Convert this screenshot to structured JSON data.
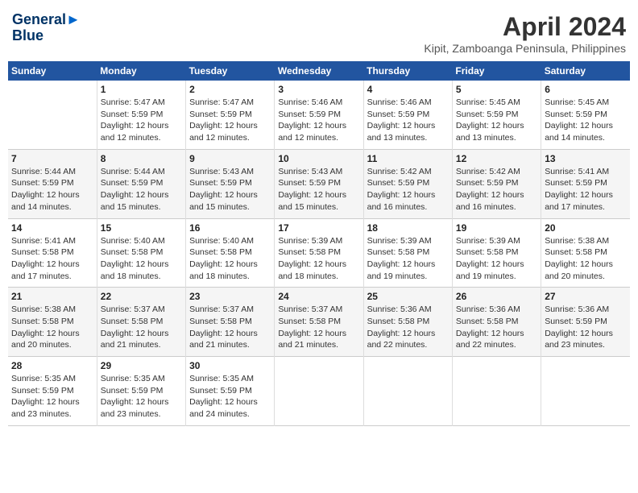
{
  "header": {
    "logo": {
      "line1": "General",
      "line2": "Blue"
    },
    "title": "April 2024",
    "subtitle": "Kipit, Zamboanga Peninsula, Philippines"
  },
  "calendar": {
    "days_header": [
      "Sunday",
      "Monday",
      "Tuesday",
      "Wednesday",
      "Thursday",
      "Friday",
      "Saturday"
    ],
    "weeks": [
      {
        "days": [
          {
            "num": "",
            "info": ""
          },
          {
            "num": "1",
            "info": "Sunrise: 5:47 AM\nSunset: 5:59 PM\nDaylight: 12 hours\nand 12 minutes."
          },
          {
            "num": "2",
            "info": "Sunrise: 5:47 AM\nSunset: 5:59 PM\nDaylight: 12 hours\nand 12 minutes."
          },
          {
            "num": "3",
            "info": "Sunrise: 5:46 AM\nSunset: 5:59 PM\nDaylight: 12 hours\nand 12 minutes."
          },
          {
            "num": "4",
            "info": "Sunrise: 5:46 AM\nSunset: 5:59 PM\nDaylight: 12 hours\nand 13 minutes."
          },
          {
            "num": "5",
            "info": "Sunrise: 5:45 AM\nSunset: 5:59 PM\nDaylight: 12 hours\nand 13 minutes."
          },
          {
            "num": "6",
            "info": "Sunrise: 5:45 AM\nSunset: 5:59 PM\nDaylight: 12 hours\nand 14 minutes."
          }
        ]
      },
      {
        "days": [
          {
            "num": "7",
            "info": "Sunrise: 5:44 AM\nSunset: 5:59 PM\nDaylight: 12 hours\nand 14 minutes."
          },
          {
            "num": "8",
            "info": "Sunrise: 5:44 AM\nSunset: 5:59 PM\nDaylight: 12 hours\nand 15 minutes."
          },
          {
            "num": "9",
            "info": "Sunrise: 5:43 AM\nSunset: 5:59 PM\nDaylight: 12 hours\nand 15 minutes."
          },
          {
            "num": "10",
            "info": "Sunrise: 5:43 AM\nSunset: 5:59 PM\nDaylight: 12 hours\nand 15 minutes."
          },
          {
            "num": "11",
            "info": "Sunrise: 5:42 AM\nSunset: 5:59 PM\nDaylight: 12 hours\nand 16 minutes."
          },
          {
            "num": "12",
            "info": "Sunrise: 5:42 AM\nSunset: 5:59 PM\nDaylight: 12 hours\nand 16 minutes."
          },
          {
            "num": "13",
            "info": "Sunrise: 5:41 AM\nSunset: 5:59 PM\nDaylight: 12 hours\nand 17 minutes."
          }
        ]
      },
      {
        "days": [
          {
            "num": "14",
            "info": "Sunrise: 5:41 AM\nSunset: 5:58 PM\nDaylight: 12 hours\nand 17 minutes."
          },
          {
            "num": "15",
            "info": "Sunrise: 5:40 AM\nSunset: 5:58 PM\nDaylight: 12 hours\nand 18 minutes."
          },
          {
            "num": "16",
            "info": "Sunrise: 5:40 AM\nSunset: 5:58 PM\nDaylight: 12 hours\nand 18 minutes."
          },
          {
            "num": "17",
            "info": "Sunrise: 5:39 AM\nSunset: 5:58 PM\nDaylight: 12 hours\nand 18 minutes."
          },
          {
            "num": "18",
            "info": "Sunrise: 5:39 AM\nSunset: 5:58 PM\nDaylight: 12 hours\nand 19 minutes."
          },
          {
            "num": "19",
            "info": "Sunrise: 5:39 AM\nSunset: 5:58 PM\nDaylight: 12 hours\nand 19 minutes."
          },
          {
            "num": "20",
            "info": "Sunrise: 5:38 AM\nSunset: 5:58 PM\nDaylight: 12 hours\nand 20 minutes."
          }
        ]
      },
      {
        "days": [
          {
            "num": "21",
            "info": "Sunrise: 5:38 AM\nSunset: 5:58 PM\nDaylight: 12 hours\nand 20 minutes."
          },
          {
            "num": "22",
            "info": "Sunrise: 5:37 AM\nSunset: 5:58 PM\nDaylight: 12 hours\nand 21 minutes."
          },
          {
            "num": "23",
            "info": "Sunrise: 5:37 AM\nSunset: 5:58 PM\nDaylight: 12 hours\nand 21 minutes."
          },
          {
            "num": "24",
            "info": "Sunrise: 5:37 AM\nSunset: 5:58 PM\nDaylight: 12 hours\nand 21 minutes."
          },
          {
            "num": "25",
            "info": "Sunrise: 5:36 AM\nSunset: 5:58 PM\nDaylight: 12 hours\nand 22 minutes."
          },
          {
            "num": "26",
            "info": "Sunrise: 5:36 AM\nSunset: 5:58 PM\nDaylight: 12 hours\nand 22 minutes."
          },
          {
            "num": "27",
            "info": "Sunrise: 5:36 AM\nSunset: 5:59 PM\nDaylight: 12 hours\nand 23 minutes."
          }
        ]
      },
      {
        "days": [
          {
            "num": "28",
            "info": "Sunrise: 5:35 AM\nSunset: 5:59 PM\nDaylight: 12 hours\nand 23 minutes."
          },
          {
            "num": "29",
            "info": "Sunrise: 5:35 AM\nSunset: 5:59 PM\nDaylight: 12 hours\nand 23 minutes."
          },
          {
            "num": "30",
            "info": "Sunrise: 5:35 AM\nSunset: 5:59 PM\nDaylight: 12 hours\nand 24 minutes."
          },
          {
            "num": "",
            "info": ""
          },
          {
            "num": "",
            "info": ""
          },
          {
            "num": "",
            "info": ""
          },
          {
            "num": "",
            "info": ""
          }
        ]
      }
    ]
  }
}
